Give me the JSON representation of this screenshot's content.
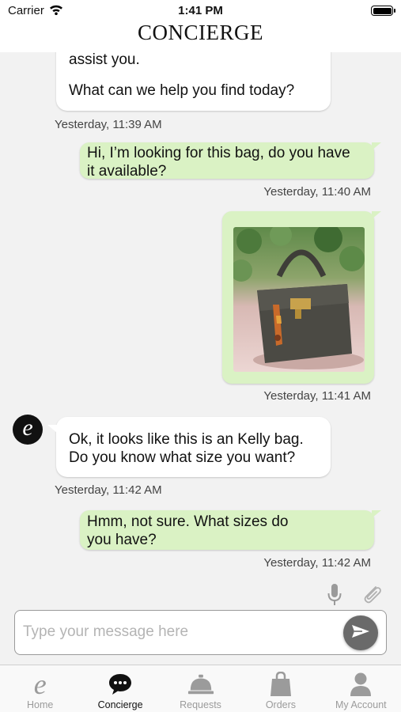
{
  "status_bar": {
    "carrier": "Carrier",
    "time": "1:41 PM",
    "battery_level": 1.0
  },
  "header": {
    "title": "CONCIERGE"
  },
  "chat": {
    "messages": [
      {
        "sender": "agent",
        "lines": [
          "assist you.",
          "What can we help you find today?"
        ],
        "timestamp": "Yesterday, 11:39 AM"
      },
      {
        "sender": "user",
        "lines": [
          "Hi, I’m looking for this bag, do you have",
          "it available?"
        ],
        "timestamp": "Yesterday, 11:40 AM"
      },
      {
        "sender": "user",
        "attachment": "bag-photo",
        "timestamp": "Yesterday, 11:41 AM"
      },
      {
        "sender": "agent",
        "avatar_letter": "e",
        "lines": [
          "Ok, it looks like this is an Kelly bag.",
          "Do you know what size you want?"
        ],
        "timestamp": "Yesterday, 11:42 AM"
      },
      {
        "sender": "user",
        "lines": [
          "Hmm, not sure. What sizes do",
          "you have?"
        ],
        "timestamp": "Yesterday, 11:42 AM"
      }
    ]
  },
  "composer": {
    "placeholder": "Type your message here",
    "value": "",
    "mic_icon": "microphone-icon",
    "attach_icon": "paperclip-icon",
    "send_icon": "send-icon"
  },
  "tab_bar": {
    "tabs": [
      {
        "label": "Home",
        "icon": "home-e-logo-icon",
        "active": false
      },
      {
        "label": "Concierge",
        "icon": "chat-bubble-icon",
        "active": true
      },
      {
        "label": "Requests",
        "icon": "service-bell-icon",
        "active": false
      },
      {
        "label": "Orders",
        "icon": "shopping-bag-icon",
        "active": false
      },
      {
        "label": "My Account",
        "icon": "person-icon",
        "active": false
      }
    ]
  },
  "colors": {
    "outgoing_bubble": "#daf2c4",
    "incoming_bubble": "#ffffff",
    "background": "#f2f2f2",
    "send_button": "#6a6a6a"
  }
}
